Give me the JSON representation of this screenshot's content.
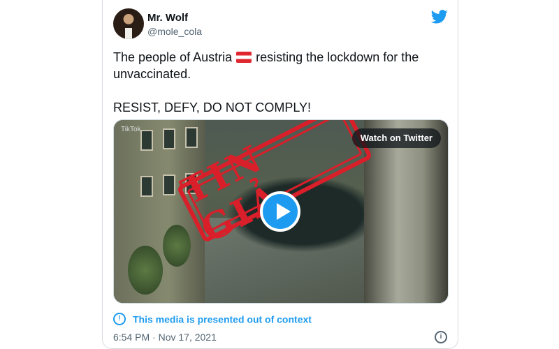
{
  "tweet": {
    "display_name": "Mr. Wolf",
    "handle": "@mole_cola",
    "text_part1": "The people of Austria",
    "flag_icon": "austria-flag-icon",
    "text_part2": "resisting the lockdown for the unvaccinated.",
    "text_line2": "RESIST, DEFY, DO NOT COMPLY!",
    "timestamp": "6:54 PM · Nov 17, 2021"
  },
  "media": {
    "watermark": "TikTok",
    "watch_label": "Watch on Twitter",
    "stamp_text": "TIN GIẢ"
  },
  "notice": {
    "text": "This media is presented out of context"
  },
  "colors": {
    "accent": "#1d9bf0",
    "stamp": "#d81f2a"
  }
}
